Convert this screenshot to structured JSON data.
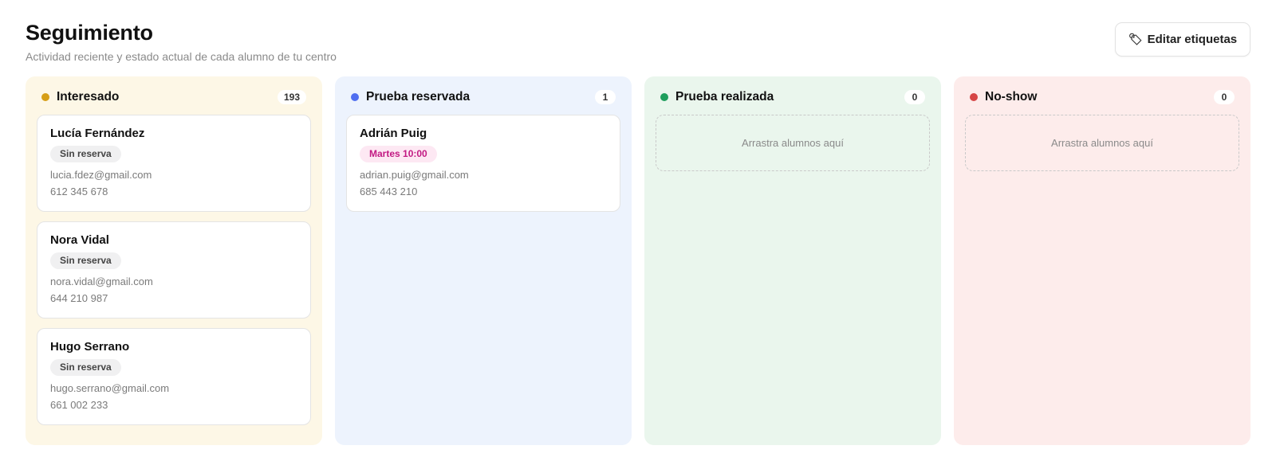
{
  "header": {
    "title": "Seguimiento",
    "subtitle": "Actividad reciente y estado actual de cada alumno de tu centro"
  },
  "toolbar": {
    "edit_label": "Editar etiquetas",
    "edit_icon": "tag-icon"
  },
  "columns": [
    {
      "title": "Interesado",
      "count": "193",
      "color": "#d69e16",
      "background": "#fdf7e6",
      "cards": [
        {
          "name": "Lucía Fernández",
          "status": "Sin reserva",
          "email": "lucia.fdez@gmail.com",
          "phone": "612 345 678"
        },
        {
          "name": "Nora Vidal",
          "status": "Sin reserva",
          "email": "nora.vidal@gmail.com",
          "phone": "644 210 987"
        },
        {
          "name": "Hugo Serrano",
          "status": "Sin reserva",
          "email": "hugo.serrano@gmail.com",
          "phone": "661 002 233"
        }
      ]
    },
    {
      "title": "Prueba reservada",
      "count": "1",
      "color": "#4f6ef0",
      "background": "#edf3fd",
      "cards": [
        {
          "name": "Adrián Puig",
          "status": "Martes 10:00",
          "email": "adrian.puig@gmail.com",
          "phone": "685 443 210"
        }
      ]
    },
    {
      "title": "Prueba realizada",
      "count": "0",
      "color": "#1e9e5c",
      "background": "#eaf6ed",
      "drop_text": "Arrastra alumnos aquí"
    },
    {
      "title": "No-show",
      "count": "0",
      "color": "#d64545",
      "background": "#fdeceb",
      "drop_text": "Arrastra alumnos aquí"
    }
  ]
}
